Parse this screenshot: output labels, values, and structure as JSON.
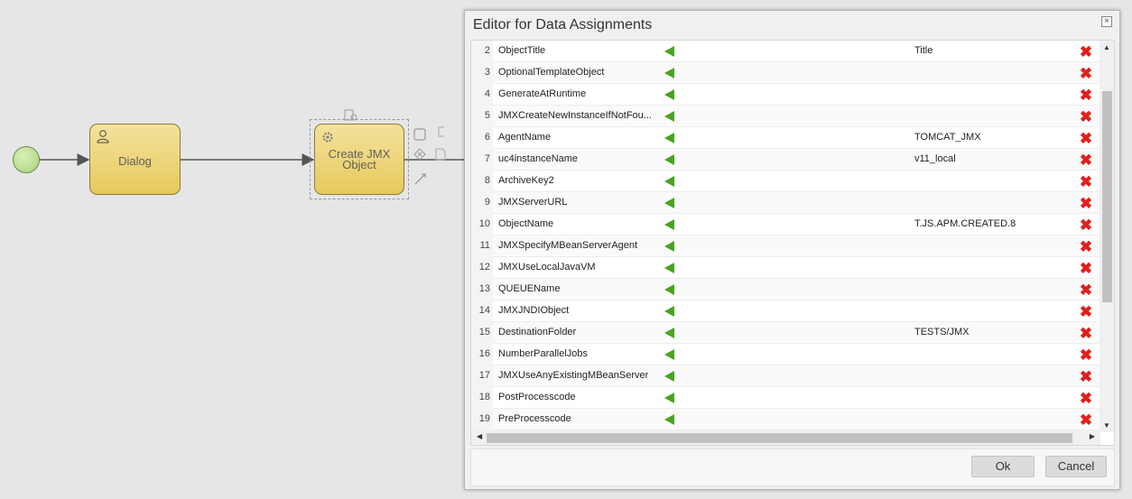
{
  "process": {
    "task1_label": "Dialog",
    "task2_label": "Create JMX Object"
  },
  "dialog": {
    "title": "Editor for Data Assignments",
    "close_label": "×",
    "ok_label": "Ok",
    "cancel_label": "Cancel",
    "rows": [
      {
        "num": "2",
        "name": "ObjectTitle",
        "value": "Title"
      },
      {
        "num": "3",
        "name": "OptionalTemplateObject",
        "value": ""
      },
      {
        "num": "4",
        "name": "GenerateAtRuntime",
        "value": ""
      },
      {
        "num": "5",
        "name": "JMXCreateNewInstanceIfNotFou...",
        "value": ""
      },
      {
        "num": "6",
        "name": "AgentName",
        "value": "TOMCAT_JMX"
      },
      {
        "num": "7",
        "name": "uc4instanceName",
        "value": "v11_local"
      },
      {
        "num": "8",
        "name": "ArchiveKey2",
        "value": ""
      },
      {
        "num": "9",
        "name": "JMXServerURL",
        "value": ""
      },
      {
        "num": "10",
        "name": "ObjectName",
        "value": "T.JS.APM.CREATED.8"
      },
      {
        "num": "11",
        "name": "JMXSpecifyMBeanServerAgent",
        "value": ""
      },
      {
        "num": "12",
        "name": "JMXUseLocalJavaVM",
        "value": ""
      },
      {
        "num": "13",
        "name": "QUEUEName",
        "value": ""
      },
      {
        "num": "14",
        "name": "JMXJNDIObject",
        "value": ""
      },
      {
        "num": "15",
        "name": "DestinationFolder",
        "value": "TESTS/JMX"
      },
      {
        "num": "16",
        "name": "NumberParallelJobs",
        "value": ""
      },
      {
        "num": "17",
        "name": "JMXUseAnyExistingMBeanServer",
        "value": ""
      },
      {
        "num": "18",
        "name": "PostProcesscode",
        "value": ""
      },
      {
        "num": "19",
        "name": "PreProcesscode",
        "value": ""
      }
    ]
  },
  "icons": {
    "assign": "arrow-left-icon",
    "delete": "delete-icon",
    "user": "user-icon",
    "gear": "gear-icon"
  },
  "colors": {
    "arrow": "#4aa320",
    "delete": "#e0201c",
    "task_fill": "#e6c95c",
    "start_event": "#a9d47a"
  }
}
